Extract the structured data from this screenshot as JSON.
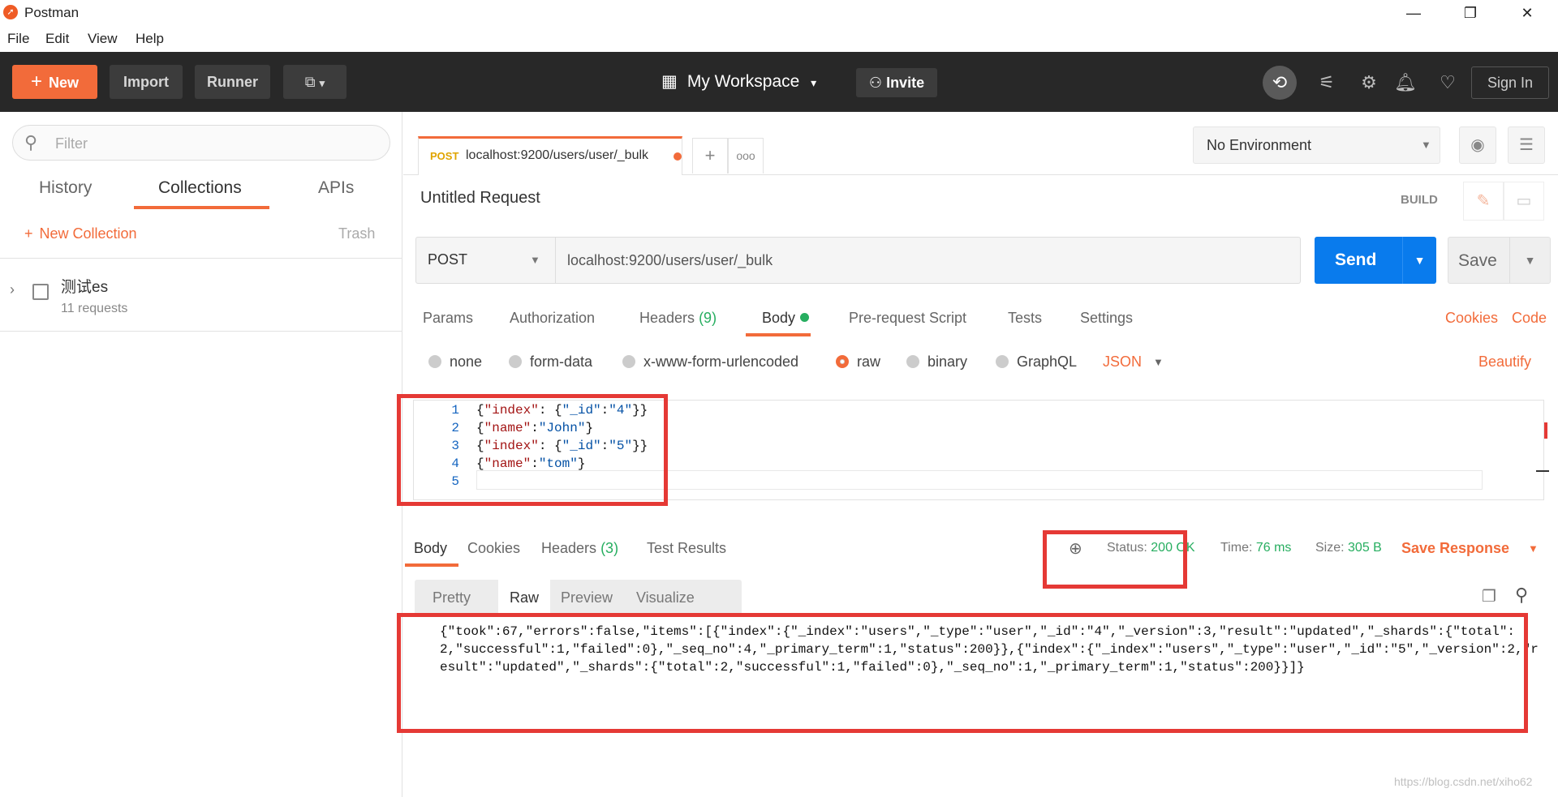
{
  "window": {
    "title": "Postman",
    "menu": [
      "File",
      "Edit",
      "View",
      "Help"
    ]
  },
  "header": {
    "new_label": "New",
    "import_label": "Import",
    "runner_label": "Runner",
    "workspace_label": "My Workspace",
    "invite_label": "Invite",
    "signin_label": "Sign In"
  },
  "sidebar": {
    "filter_placeholder": "Filter",
    "tabs": [
      "History",
      "Collections",
      "APIs"
    ],
    "new_collection_label": "New Collection",
    "trash_label": "Trash",
    "collection": {
      "name": "测试es",
      "count": "11 requests"
    }
  },
  "request": {
    "tab_method": "POST",
    "tab_url": "localhost:9200/users/user/_bulk",
    "name": "Untitled Request",
    "build_label": "BUILD",
    "method": "POST",
    "url": "localhost:9200/users/user/_bulk",
    "send_label": "Send",
    "save_label": "Save",
    "environment": "No Environment",
    "tabs": {
      "params": "Params",
      "authorization": "Authorization",
      "headers": "Headers",
      "headers_count": "(9)",
      "body": "Body",
      "prerequest": "Pre-request Script",
      "tests": "Tests",
      "settings": "Settings"
    },
    "cookies_label": "Cookies",
    "code_label": "Code",
    "body_options": {
      "none": "none",
      "form_data": "form-data",
      "urlencoded": "x-www-form-urlencoded",
      "raw": "raw",
      "binary": "binary",
      "graphql": "GraphQL"
    },
    "body_type": "JSON",
    "beautify_label": "Beautify",
    "code_lines": [
      {
        "n": "1",
        "p": [
          "{",
          "\"index\"",
          ": {",
          "\"_id\"",
          ":",
          "\"4\"",
          "}}"
        ]
      },
      {
        "n": "2",
        "p": [
          "{",
          "\"name\"",
          ":",
          "\"John\"",
          "}"
        ]
      },
      {
        "n": "3",
        "p": [
          "{",
          "\"index\"",
          ": {",
          "\"_id\"",
          ":",
          "\"5\"",
          "}}"
        ]
      },
      {
        "n": "4",
        "p": [
          "{",
          "\"name\"",
          ":",
          "\"tom\"",
          "}"
        ]
      },
      {
        "n": "5",
        "p": []
      }
    ]
  },
  "response": {
    "tabs": {
      "body": "Body",
      "cookies": "Cookies",
      "headers": "Headers",
      "headers_count": "(3)",
      "test_results": "Test Results"
    },
    "status_label": "Status:",
    "status_value": "200 OK",
    "time_label": "Time:",
    "time_value": "76 ms",
    "size_label": "Size:",
    "size_value": "305 B",
    "save_response_label": "Save Response",
    "view_tabs": [
      "Pretty",
      "Raw",
      "Preview",
      "Visualize"
    ],
    "body_text": "{\"took\":67,\"errors\":false,\"items\":[{\"index\":{\"_index\":\"users\",\"_type\":\"user\",\"_id\":\"4\",\"_version\":3,\"result\":\"updated\",\"_shards\":{\"total\":2,\"successful\":1,\"failed\":0},\"_seq_no\":4,\"_primary_term\":1,\"status\":200}},{\"index\":{\"_index\":\"users\",\"_type\":\"user\",\"_id\":\"5\",\"_version\":2,\"result\":\"updated\",\"_shards\":{\"total\":2,\"successful\":1,\"failed\":0},\"_seq_no\":1,\"_primary_term\":1,\"status\":200}}]}"
  },
  "watermark": "https://blog.csdn.net/xiho62",
  "colors": {
    "accent": "#f26b3a",
    "send": "#097bed",
    "success": "#27ae60",
    "highlight": "#e53935"
  }
}
